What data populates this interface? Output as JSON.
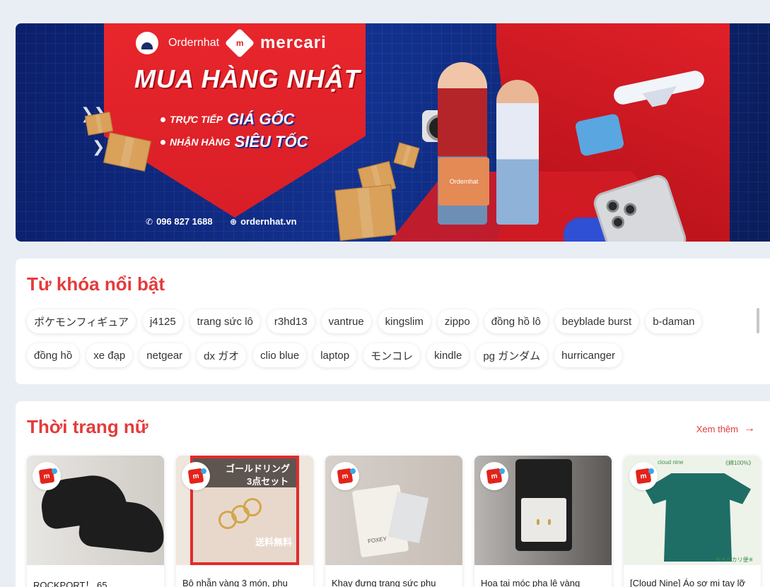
{
  "banner": {
    "brand_name": "Ordernhat",
    "partner_name": "mercari",
    "partner_mark": "m",
    "headline": "MUA HÀNG NHẬT",
    "line1_small": "TRỰC TIẾP",
    "line1_big": "GIÁ GỐC",
    "line2_small": "NHẬN HÀNG",
    "line2_big": "SIÊU TỐC",
    "phone": "096 827 1688",
    "website": "ordernhat.vn",
    "bag_label": "Ordernhat",
    "colors": {
      "red": "#e8262c",
      "navy": "#12318f"
    }
  },
  "keywords": {
    "title": "Từ khóa nổi bật",
    "row1": [
      "ポケモンフィギュア",
      "j4125",
      "trang sức lô",
      "r3hd13",
      "vantrue",
      "kingslim",
      "zippo",
      "đồng hồ lô",
      "beyblade burst",
      "b-daman"
    ],
    "row2": [
      "đồng hồ",
      "xe đạp",
      "netgear",
      "dx ガオ",
      "clio blue",
      "laptop",
      "モンコレ",
      "kindle",
      "pg ガンダム",
      "hurricanger"
    ]
  },
  "fashion": {
    "title": "Thời trang nữ",
    "see_more": "Xem thêm",
    "products": [
      {
        "title": "ROCKPORT！ 65"
      },
      {
        "title": "Bộ nhẫn vàng 3 món, phụ",
        "image_text_1": "ゴールドリング",
        "image_text_2": "3点セット",
        "image_text_3": "送料無料"
      },
      {
        "title": "Khay đựng trang sức phụ",
        "image_text_1": "FOXEY"
      },
      {
        "title": "Hoa tai móc pha lê vàng"
      },
      {
        "title": "[Cloud Nine] Áo sơ mi tay lỡ",
        "image_text_1": "cloud nine",
        "image_text_2": "《綿100%》",
        "image_text_3": "※メルカリ便※"
      }
    ]
  },
  "accent_color": "#e43b3b"
}
